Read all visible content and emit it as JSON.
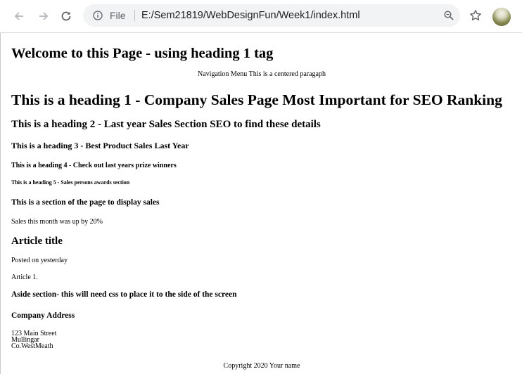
{
  "browser": {
    "scheme_label": "File",
    "url": "E:/Sem21819/WebDesignFun/Week1/index.html"
  },
  "page": {
    "header_title": "Welcome to this Page - using heading 1 tag",
    "nav_text": "Navigation Menu This is a centered paragaph",
    "heading1": "This is a heading 1 - Company Sales Page Most Important for SEO Ranking",
    "heading2": "This is a heading 2 - Last year Sales Section SEO to find these details",
    "heading3": "This is a heading 3 - Best Product Sales Last Year",
    "heading4": "This is a heading 4 - Check out last years prize winners",
    "heading5": "This is a heading 5 - Sales persons awards section",
    "section_title": "This is a section of the page to display sales",
    "sales_text": "Sales this month was up by 20%",
    "article_title": "Article title",
    "posted_text": "Posted on yesterday",
    "article_body": "Article 1.",
    "aside_title": "Aside section- this will need css to place it to the side of the screen",
    "company_title": "Company Address",
    "address": [
      "123 Main Street",
      "Mullingar",
      "Co.WestMeath"
    ],
    "footer": "Copyright 2020 Your name"
  }
}
